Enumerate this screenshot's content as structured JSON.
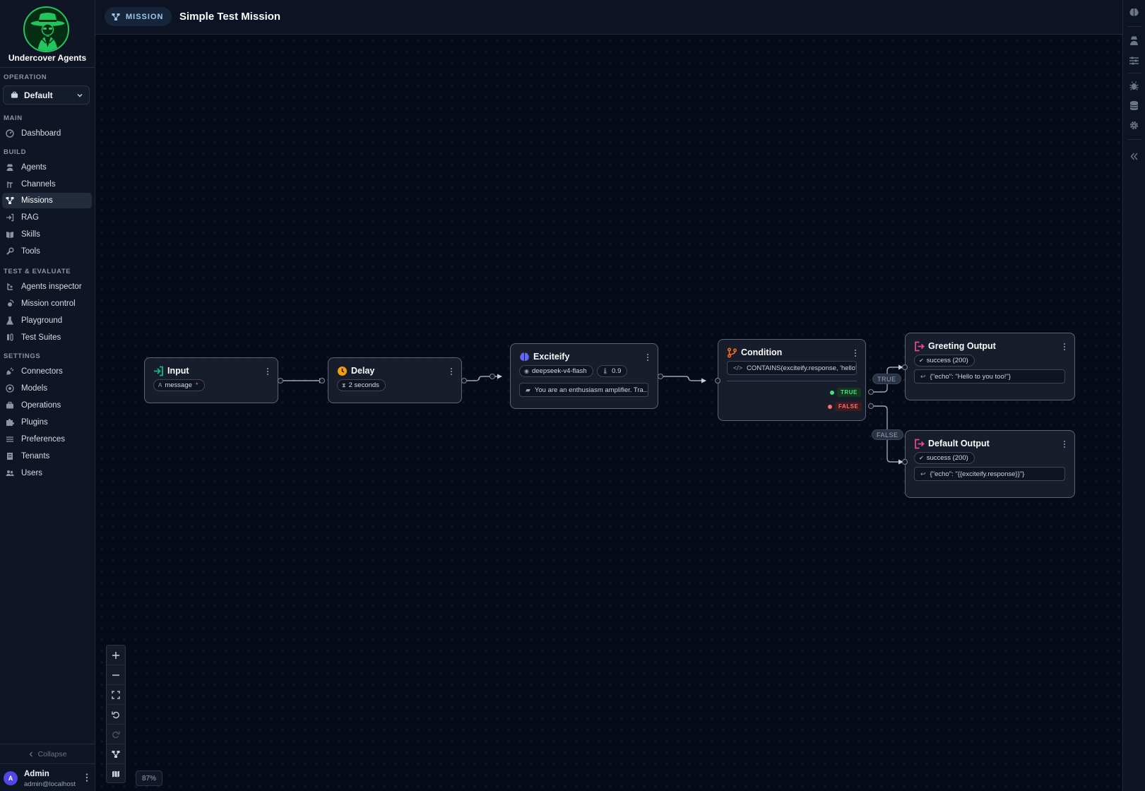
{
  "brand": {
    "name": "Undercover Agents"
  },
  "operation": {
    "label": "OPERATION",
    "selected": "Default"
  },
  "sections": {
    "main": "MAIN",
    "build": "BUILD",
    "test": "TEST & EVALUATE",
    "settings": "SETTINGS"
  },
  "nav": {
    "dashboard": "Dashboard",
    "agents": "Agents",
    "channels": "Channels",
    "missions": "Missions",
    "rag": "RAG",
    "skills": "Skills",
    "tools": "Tools",
    "agents_inspector": "Agents inspector",
    "mission_control": "Mission control",
    "playground": "Playground",
    "test_suites": "Test Suites",
    "connectors": "Connectors",
    "models": "Models",
    "operations": "Operations",
    "plugins": "Plugins",
    "preferences": "Preferences",
    "tenants": "Tenants",
    "users": "Users"
  },
  "sidebar_footer": {
    "collapse": "Collapse"
  },
  "user": {
    "initial": "A",
    "name": "Admin",
    "email": "admin@localhost"
  },
  "header": {
    "badge": "MISSION",
    "title": "Simple Test Mission"
  },
  "nodes": {
    "input": {
      "title": "Input",
      "chip": "message",
      "required_mark": "*"
    },
    "delay": {
      "title": "Delay",
      "chip": "2 seconds"
    },
    "exciteify": {
      "title": "Exciteify",
      "model": "deepseek-v4-flash",
      "temperature": "0.9",
      "prompt": "You are an enthusiasm amplifier. Tra..."
    },
    "condition": {
      "title": "Condition",
      "expression": "CONTAINS(exciteify.response, 'hello')",
      "true_label": "TRUE",
      "false_label": "FALSE"
    },
    "greeting": {
      "title": "Greeting Output",
      "status": "success (200)",
      "body": "{\"echo\": \"Hello to you too!\"}"
    },
    "default": {
      "title": "Default Output",
      "status": "success (200)",
      "body": "{\"echo\": \"{{exciteify.response}}\"}"
    }
  },
  "edge_labels": {
    "true": "TRUE",
    "false": "FALSE"
  },
  "zoom": "87%",
  "colors": {
    "accent_green": "#22c55e",
    "true_green": "#4ade80",
    "false_red": "#f87171",
    "output_pink": "#ec4899",
    "delay_orange": "#f59e0b",
    "brain_blue": "#6366f1",
    "input_teal": "#10b981"
  }
}
